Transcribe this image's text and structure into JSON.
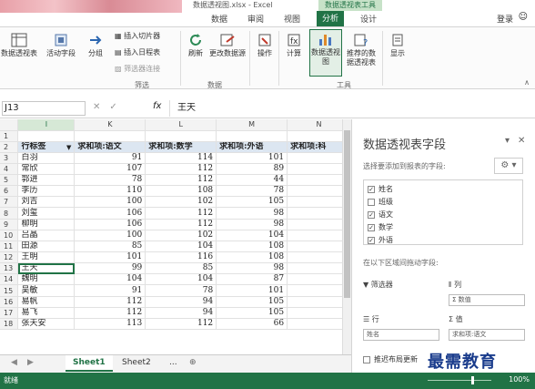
{
  "window": {
    "title": "数据透视图.xlsx - Excel",
    "context_tab_header": "数据透视表工具",
    "login": "登录"
  },
  "tabs": [
    "数据",
    "审阅",
    "视图",
    "分析",
    "设计"
  ],
  "active_tab": "分析",
  "ribbon": {
    "btn_pivot_table": "数据透视表",
    "btn_active_field": "活动字段",
    "btn_group": "分组",
    "insert_slicer": "插入切片器",
    "insert_timeline": "插入日程表",
    "filter_connections": "筛选器连接",
    "group_filter": "筛选",
    "btn_refresh": "刷新",
    "btn_change_source": "更改数据源",
    "group_data": "数据",
    "btn_actions": "操作",
    "btn_calculations": "计算",
    "btn_pivot_chart": "数据透视图",
    "btn_recommended": "推荐的数据透视表",
    "group_tools": "工具",
    "btn_show": "显示"
  },
  "formula_bar": {
    "name_box": "J13",
    "fx": "fx",
    "value": "王天"
  },
  "sheet": {
    "columns": [
      "I",
      "K",
      "L",
      "M",
      "N"
    ],
    "selected_column": "I",
    "selected_row": "13",
    "header_row": [
      "行标签",
      "求和项:语文",
      "求和项:数学",
      "求和项:外语",
      "求和项:科"
    ],
    "rows": [
      {
        "n": "3",
        "name": "白羽",
        "v": [
          "91",
          "114",
          "101"
        ]
      },
      {
        "n": "4",
        "name": "常欣",
        "v": [
          "107",
          "112",
          "89"
        ]
      },
      {
        "n": "5",
        "name": "郭进",
        "v": [
          "78",
          "112",
          "44"
        ]
      },
      {
        "n": "6",
        "name": "李历",
        "v": [
          "110",
          "108",
          "78"
        ]
      },
      {
        "n": "7",
        "name": "刘吉",
        "v": [
          "100",
          "102",
          "105"
        ]
      },
      {
        "n": "8",
        "name": "刘玺",
        "v": [
          "106",
          "112",
          "98"
        ]
      },
      {
        "n": "9",
        "name": "柳明",
        "v": [
          "106",
          "112",
          "98"
        ]
      },
      {
        "n": "10",
        "name": "吕晶",
        "v": [
          "100",
          "102",
          "104"
        ]
      },
      {
        "n": "11",
        "name": "田源",
        "v": [
          "85",
          "104",
          "108"
        ]
      },
      {
        "n": "12",
        "name": "王明",
        "v": [
          "101",
          "116",
          "108"
        ]
      },
      {
        "n": "13",
        "name": "王天",
        "v": [
          "99",
          "85",
          "98"
        ]
      },
      {
        "n": "14",
        "name": "魏明",
        "v": [
          "104",
          "104",
          "87"
        ]
      },
      {
        "n": "15",
        "name": "吴敏",
        "v": [
          "91",
          "78",
          "101"
        ]
      },
      {
        "n": "16",
        "name": "易帆",
        "v": [
          "112",
          "94",
          "105"
        ]
      },
      {
        "n": "17",
        "name": "易飞",
        "v": [
          "112",
          "94",
          "105"
        ]
      },
      {
        "n": "18",
        "name": "张天安",
        "v": [
          "113",
          "112",
          "66"
        ]
      }
    ]
  },
  "sheet_tabs": [
    "Sheet1",
    "Sheet2",
    "..."
  ],
  "pane": {
    "title": "数据透视表字段",
    "subtitle": "选择要添加到报表的字段:",
    "fields": [
      {
        "label": "姓名",
        "checked": true
      },
      {
        "label": "班级",
        "checked": false
      },
      {
        "label": "语文",
        "checked": true
      },
      {
        "label": "数学",
        "checked": true
      },
      {
        "label": "外语",
        "checked": true
      }
    ],
    "drag_label": "在以下区域间拖动字段:",
    "area_filter": "筛选器",
    "area_columns": "列",
    "area_rows": "行",
    "area_values": "值",
    "col_item": "Σ 数值",
    "row_item": "姓名",
    "val_item": "求和项:语文",
    "defer": "推迟布局更新"
  },
  "status": {
    "ready": "就绪",
    "zoom": "100%"
  },
  "watermark": "最需教育"
}
